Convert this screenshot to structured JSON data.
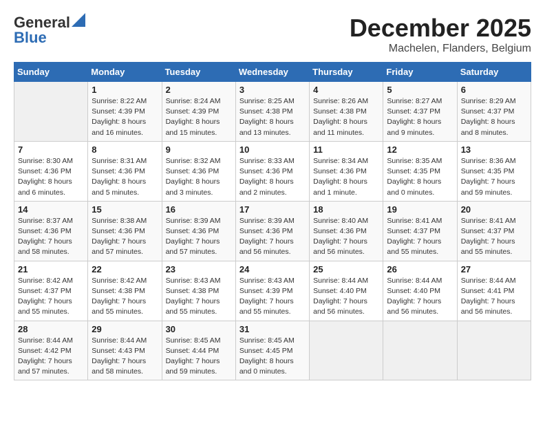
{
  "logo": {
    "general": "General",
    "blue": "Blue"
  },
  "header": {
    "month": "December 2025",
    "location": "Machelen, Flanders, Belgium"
  },
  "days_of_week": [
    "Sunday",
    "Monday",
    "Tuesday",
    "Wednesday",
    "Thursday",
    "Friday",
    "Saturday"
  ],
  "weeks": [
    [
      {
        "day": "",
        "info": ""
      },
      {
        "day": "1",
        "info": "Sunrise: 8:22 AM\nSunset: 4:39 PM\nDaylight: 8 hours\nand 16 minutes."
      },
      {
        "day": "2",
        "info": "Sunrise: 8:24 AM\nSunset: 4:39 PM\nDaylight: 8 hours\nand 15 minutes."
      },
      {
        "day": "3",
        "info": "Sunrise: 8:25 AM\nSunset: 4:38 PM\nDaylight: 8 hours\nand 13 minutes."
      },
      {
        "day": "4",
        "info": "Sunrise: 8:26 AM\nSunset: 4:38 PM\nDaylight: 8 hours\nand 11 minutes."
      },
      {
        "day": "5",
        "info": "Sunrise: 8:27 AM\nSunset: 4:37 PM\nDaylight: 8 hours\nand 9 minutes."
      },
      {
        "day": "6",
        "info": "Sunrise: 8:29 AM\nSunset: 4:37 PM\nDaylight: 8 hours\nand 8 minutes."
      }
    ],
    [
      {
        "day": "7",
        "info": "Sunrise: 8:30 AM\nSunset: 4:36 PM\nDaylight: 8 hours\nand 6 minutes."
      },
      {
        "day": "8",
        "info": "Sunrise: 8:31 AM\nSunset: 4:36 PM\nDaylight: 8 hours\nand 5 minutes."
      },
      {
        "day": "9",
        "info": "Sunrise: 8:32 AM\nSunset: 4:36 PM\nDaylight: 8 hours\nand 3 minutes."
      },
      {
        "day": "10",
        "info": "Sunrise: 8:33 AM\nSunset: 4:36 PM\nDaylight: 8 hours\nand 2 minutes."
      },
      {
        "day": "11",
        "info": "Sunrise: 8:34 AM\nSunset: 4:36 PM\nDaylight: 8 hours\nand 1 minute."
      },
      {
        "day": "12",
        "info": "Sunrise: 8:35 AM\nSunset: 4:35 PM\nDaylight: 8 hours\nand 0 minutes."
      },
      {
        "day": "13",
        "info": "Sunrise: 8:36 AM\nSunset: 4:35 PM\nDaylight: 7 hours\nand 59 minutes."
      }
    ],
    [
      {
        "day": "14",
        "info": "Sunrise: 8:37 AM\nSunset: 4:36 PM\nDaylight: 7 hours\nand 58 minutes."
      },
      {
        "day": "15",
        "info": "Sunrise: 8:38 AM\nSunset: 4:36 PM\nDaylight: 7 hours\nand 57 minutes."
      },
      {
        "day": "16",
        "info": "Sunrise: 8:39 AM\nSunset: 4:36 PM\nDaylight: 7 hours\nand 57 minutes."
      },
      {
        "day": "17",
        "info": "Sunrise: 8:39 AM\nSunset: 4:36 PM\nDaylight: 7 hours\nand 56 minutes."
      },
      {
        "day": "18",
        "info": "Sunrise: 8:40 AM\nSunset: 4:36 PM\nDaylight: 7 hours\nand 56 minutes."
      },
      {
        "day": "19",
        "info": "Sunrise: 8:41 AM\nSunset: 4:37 PM\nDaylight: 7 hours\nand 55 minutes."
      },
      {
        "day": "20",
        "info": "Sunrise: 8:41 AM\nSunset: 4:37 PM\nDaylight: 7 hours\nand 55 minutes."
      }
    ],
    [
      {
        "day": "21",
        "info": "Sunrise: 8:42 AM\nSunset: 4:37 PM\nDaylight: 7 hours\nand 55 minutes."
      },
      {
        "day": "22",
        "info": "Sunrise: 8:42 AM\nSunset: 4:38 PM\nDaylight: 7 hours\nand 55 minutes."
      },
      {
        "day": "23",
        "info": "Sunrise: 8:43 AM\nSunset: 4:38 PM\nDaylight: 7 hours\nand 55 minutes."
      },
      {
        "day": "24",
        "info": "Sunrise: 8:43 AM\nSunset: 4:39 PM\nDaylight: 7 hours\nand 55 minutes."
      },
      {
        "day": "25",
        "info": "Sunrise: 8:44 AM\nSunset: 4:40 PM\nDaylight: 7 hours\nand 56 minutes."
      },
      {
        "day": "26",
        "info": "Sunrise: 8:44 AM\nSunset: 4:40 PM\nDaylight: 7 hours\nand 56 minutes."
      },
      {
        "day": "27",
        "info": "Sunrise: 8:44 AM\nSunset: 4:41 PM\nDaylight: 7 hours\nand 56 minutes."
      }
    ],
    [
      {
        "day": "28",
        "info": "Sunrise: 8:44 AM\nSunset: 4:42 PM\nDaylight: 7 hours\nand 57 minutes."
      },
      {
        "day": "29",
        "info": "Sunrise: 8:44 AM\nSunset: 4:43 PM\nDaylight: 7 hours\nand 58 minutes."
      },
      {
        "day": "30",
        "info": "Sunrise: 8:45 AM\nSunset: 4:44 PM\nDaylight: 7 hours\nand 59 minutes."
      },
      {
        "day": "31",
        "info": "Sunrise: 8:45 AM\nSunset: 4:45 PM\nDaylight: 8 hours\nand 0 minutes."
      },
      {
        "day": "",
        "info": ""
      },
      {
        "day": "",
        "info": ""
      },
      {
        "day": "",
        "info": ""
      }
    ]
  ]
}
